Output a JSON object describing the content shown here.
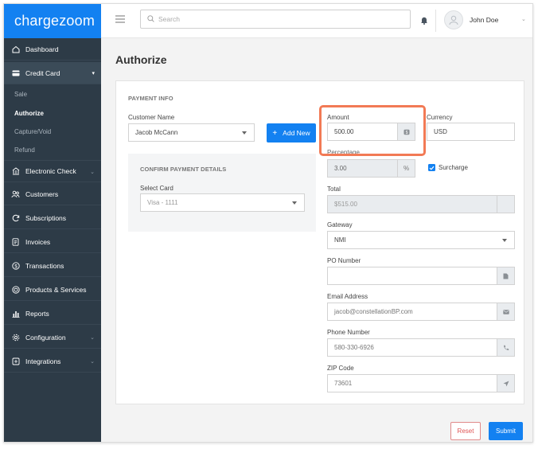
{
  "brand": {
    "logo_text": "chargezoom",
    "color": "#1381f1"
  },
  "header": {
    "search_placeholder": "Search",
    "user_name": "John Doe"
  },
  "sidebar": {
    "items": [
      {
        "label": "Dashboard",
        "icon": "home-icon"
      },
      {
        "label": "Credit Card",
        "icon": "credit-card-icon"
      },
      {
        "label": "Electronic Check",
        "icon": "bank-icon"
      },
      {
        "label": "Customers",
        "icon": "users-icon"
      },
      {
        "label": "Subscriptions",
        "icon": "refresh-icon"
      },
      {
        "label": "Invoices",
        "icon": "document-icon"
      },
      {
        "label": "Transactions",
        "icon": "dollar-icon"
      },
      {
        "label": "Products & Services",
        "icon": "box-icon"
      },
      {
        "label": "Reports",
        "icon": "bar-chart-icon"
      },
      {
        "label": "Configuration",
        "icon": "gear-icon"
      },
      {
        "label": "Integrations",
        "icon": "integration-icon"
      }
    ],
    "credit_card_sub": [
      "Sale",
      "Authorize",
      "Capture/Void",
      "Refund"
    ]
  },
  "page": {
    "title": "Authorize"
  },
  "form": {
    "payment_info_heading": "PAYMENT INFO",
    "customer_name_label": "Customer Name",
    "customer_name_value": "Jacob McCann",
    "add_new_label": "Add New",
    "confirm_heading": "CONFIRM PAYMENT DETAILS",
    "select_card_label": "Select Card",
    "select_card_value": "Visa - 1111",
    "amount_label": "Amount",
    "amount_value": "500.00",
    "currency_label": "Currency",
    "currency_value": "USD",
    "percentage_label": "Percentage",
    "percentage_value": "3.00",
    "percentage_addon": "%",
    "surcharge_label": "Surcharge",
    "surcharge_checked": true,
    "total_label": "Total",
    "total_value": "$515.00",
    "gateway_label": "Gateway",
    "gateway_value": "NMI",
    "po_label": "PO Number",
    "po_value": "",
    "email_label": "Email Address",
    "email_value": "jacob@constellationBP.com",
    "phone_label": "Phone Number",
    "phone_value": "580-330-6926",
    "zip_label": "ZIP Code",
    "zip_value": "73601"
  },
  "actions": {
    "reset_label": "Reset",
    "submit_label": "Submit"
  },
  "colors": {
    "sidebar": "#2d3b47",
    "accent": "#1381f1",
    "highlight": "#f27a55",
    "reset": "#e05555"
  }
}
